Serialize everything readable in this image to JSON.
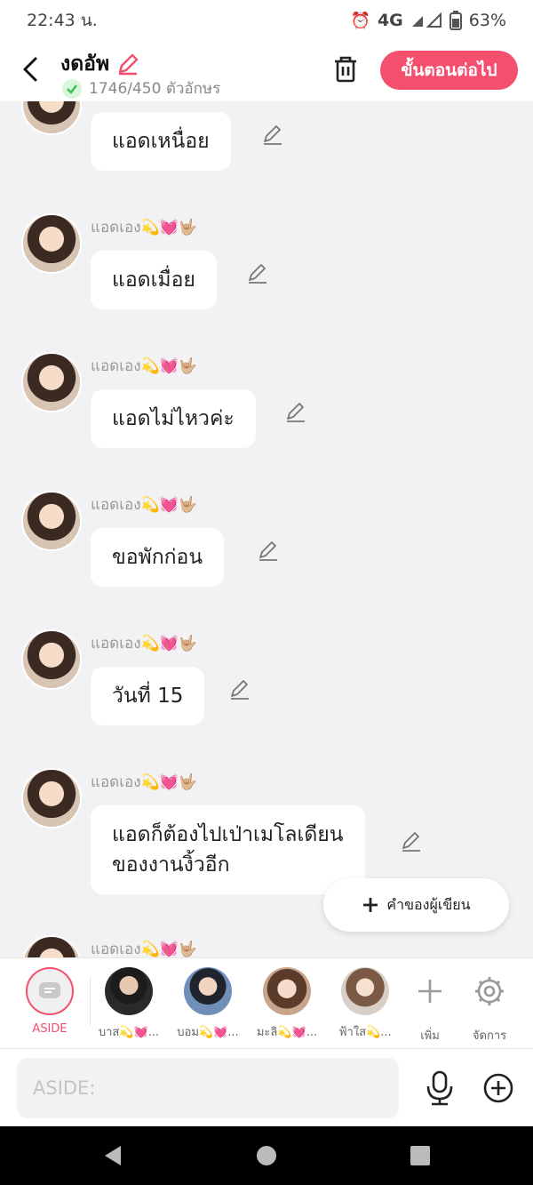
{
  "status": {
    "time": "22:43 น.",
    "network": "4G",
    "battery": "63%"
  },
  "header": {
    "title": "งดอัพ",
    "counter": "1746/450 ตัวอักษร",
    "next_label": "ขั้นตอนต่อไป"
  },
  "messages": [
    {
      "sender": "",
      "text": "แอดเหนื่อย"
    },
    {
      "sender": "แอดเอง💫💓🤟🏼",
      "text": "แอดเมื่อย"
    },
    {
      "sender": "แอดเอง💫💓🤟🏼",
      "text": "แอดไม่ไหวค่ะ"
    },
    {
      "sender": "แอดเอง💫💓🤟🏼",
      "text": "ขอพักก่อน"
    },
    {
      "sender": "แอดเอง💫💓🤟🏼",
      "text": "วันที่ 15"
    },
    {
      "sender": "แอดเอง💫💓🤟🏼",
      "text_line1": "แอดก็ต้องไปเป่าเมโลเดียน",
      "text_line2": "ของงานงิ้วอีก"
    },
    {
      "sender": "แอดเอง💫💓🤟🏼"
    }
  ],
  "author_button": "คำของผู้เขียน",
  "characters": [
    {
      "name": "ASIDE"
    },
    {
      "name": "บาส💫💓..."
    },
    {
      "name": "บอม💫💓..."
    },
    {
      "name": "มะลิ💫💓..."
    },
    {
      "name": "ฟ้าใส💫..."
    },
    {
      "name": "เพิ่ม"
    },
    {
      "name": "จัดการ"
    }
  ],
  "input": {
    "placeholder": "ASIDE:"
  },
  "colors": {
    "accent": "#f4506e",
    "background": "#f2f2f4"
  },
  "icons": [
    "back-arrow-icon",
    "pencil-icon",
    "check-icon",
    "trash-icon",
    "edit-icon",
    "plus-icon",
    "gear-icon",
    "chat-icon",
    "mic-icon",
    "add-circle-icon",
    "nav-back-icon",
    "nav-home-icon",
    "nav-recent-icon"
  ]
}
